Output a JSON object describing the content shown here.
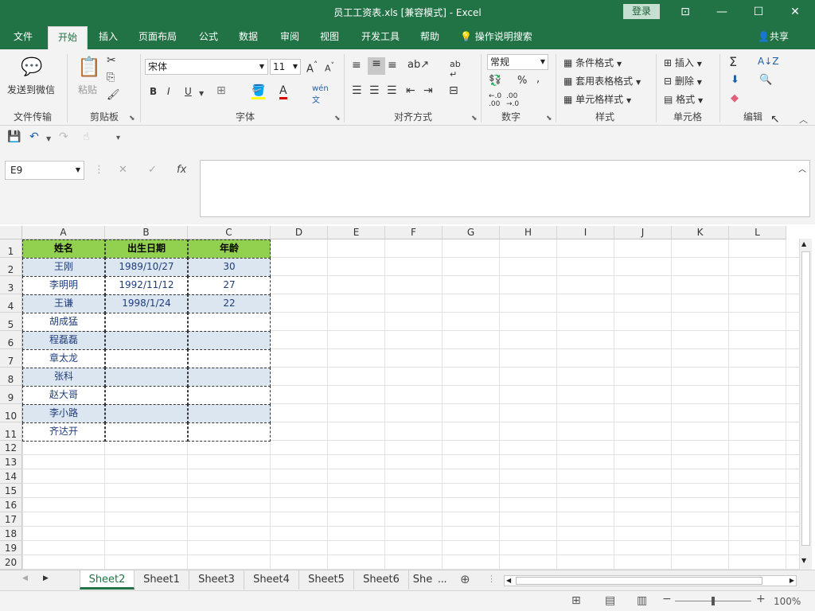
{
  "window": {
    "title": "员工工资表.xls  [兼容模式]  -  Excel",
    "login": "登录"
  },
  "tabs": [
    "文件",
    "开始",
    "插入",
    "页面布局",
    "公式",
    "数据",
    "审阅",
    "视图",
    "开发工具",
    "帮助"
  ],
  "tell_me": "操作说明搜索",
  "share": "共享",
  "ribbon": {
    "send_wechat": "发送到微信",
    "paste": "粘贴",
    "font_name": "宋体",
    "font_size": "11",
    "number_format": "常规",
    "cond_format": "条件格式",
    "table_format": "套用表格格式",
    "cell_style": "单元格样式",
    "insert": "插入",
    "delete": "删除",
    "format": "格式",
    "groups": {
      "file_transfer": "文件传输",
      "clipboard": "剪贴板",
      "font": "字体",
      "alignment": "对齐方式",
      "number": "数字",
      "styles": "样式",
      "cells": "单元格",
      "editing": "编辑"
    }
  },
  "formula": {
    "name_box": "E9",
    "fx": "fx",
    "value": ""
  },
  "grid": {
    "columns": [
      "A",
      "B",
      "C",
      "D",
      "E",
      "F",
      "G",
      "H",
      "I",
      "J",
      "K",
      "L"
    ],
    "rows": [
      "1",
      "2",
      "3",
      "4",
      "5",
      "6",
      "7",
      "8",
      "9",
      "10",
      "11",
      "12",
      "13",
      "14",
      "15",
      "16",
      "17",
      "18",
      "19",
      "20"
    ],
    "headers": [
      "姓名",
      "出生日期",
      "年龄"
    ],
    "data": [
      [
        "王刚",
        "1989/10/27",
        "30"
      ],
      [
        "李明明",
        "1992/11/12",
        "27"
      ],
      [
        "王谦",
        "1998/1/24",
        "22"
      ],
      [
        "胡成猛",
        "",
        ""
      ],
      [
        "程磊磊",
        "",
        ""
      ],
      [
        "章太龙",
        "",
        ""
      ],
      [
        "张科",
        "",
        ""
      ],
      [
        "赵大哥",
        "",
        ""
      ],
      [
        "李小路",
        "",
        ""
      ],
      [
        "齐达开",
        "",
        ""
      ]
    ]
  },
  "sheets": [
    "Sheet2",
    "Sheet1",
    "Sheet3",
    "Sheet4",
    "Sheet5",
    "Sheet6",
    "She"
  ],
  "sheets_more": "...",
  "status": {
    "zoom": "100%"
  },
  "colors": {
    "brand": "#217346",
    "header_fill": "#92d050",
    "band_fill": "#dce6f1"
  }
}
